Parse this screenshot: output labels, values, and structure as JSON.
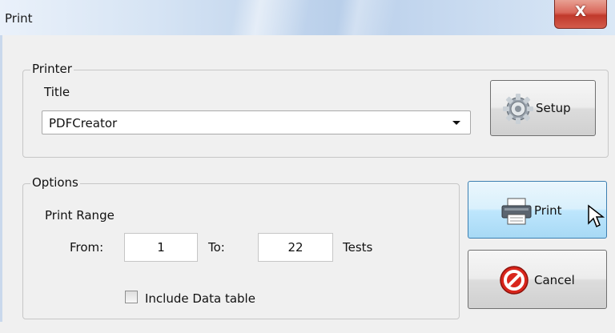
{
  "window": {
    "title": "Print",
    "close_glyph": "X"
  },
  "printer_group": {
    "legend": "Printer",
    "title_label": "Title",
    "printer_select_value": "PDFCreator",
    "setup_label": "Setup"
  },
  "options_group": {
    "legend": "Options",
    "range_label": "Print Range",
    "from_label": "From:",
    "from_value": "1",
    "to_label": "To:",
    "to_value": "22",
    "unit_label": "Tests",
    "include_data_table_label": "Include Data table",
    "include_data_table_checked": false
  },
  "actions": {
    "print_label": "Print",
    "cancel_label": "Cancel"
  },
  "icons": {
    "setup": "gear-icon",
    "print": "printer-icon",
    "cancel": "cancel-icon",
    "close": "close-icon",
    "cursor": "mouse-pointer-icon"
  },
  "colors": {
    "print_button_face": "#bee6fd",
    "close_button": "#c0392b",
    "cancel_icon": "#d9261c"
  }
}
